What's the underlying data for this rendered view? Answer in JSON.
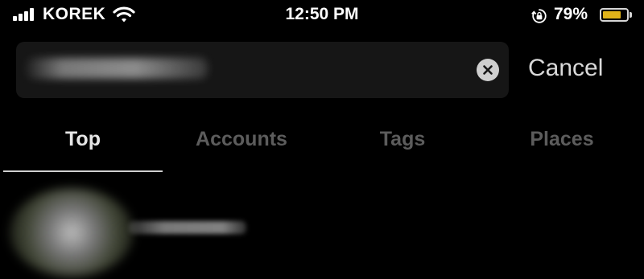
{
  "status_bar": {
    "carrier": "KOREK",
    "time": "12:50 PM",
    "battery_percent": "79%",
    "battery_level": 0.79,
    "icons": [
      "cellular-signal-icon",
      "wifi-icon",
      "orientation-lock-icon",
      "battery-icon"
    ]
  },
  "search": {
    "query_obscured": true,
    "clear_icon": "clear-x-icon",
    "cancel_label": "Cancel"
  },
  "tabs": [
    {
      "label": "Top",
      "active": true
    },
    {
      "label": "Accounts",
      "active": false
    },
    {
      "label": "Tags",
      "active": false
    },
    {
      "label": "Places",
      "active": false
    }
  ],
  "results": [
    {
      "name_obscured": true,
      "avatar_obscured": true
    }
  ],
  "colors": {
    "background": "#000000",
    "search_field": "#161616",
    "active_tab": "#e6e6e6",
    "inactive_tab": "#5c5c5c",
    "battery_fill": "#e0b319"
  }
}
